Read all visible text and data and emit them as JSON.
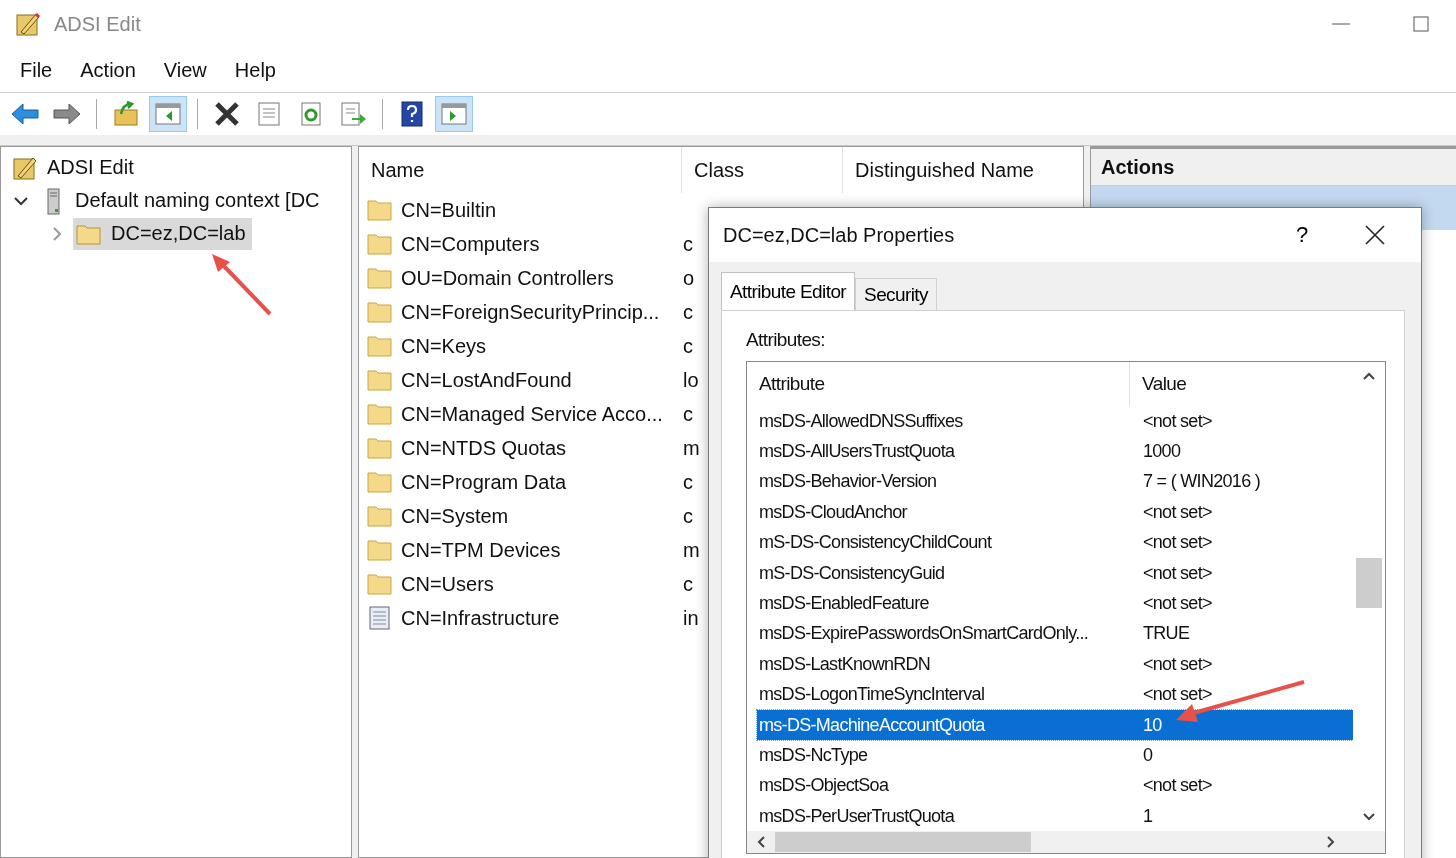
{
  "window": {
    "title": "ADSI Edit"
  },
  "menu": [
    "File",
    "Action",
    "View",
    "Help"
  ],
  "toolbar": [
    {
      "kind": "back",
      "pressed": false
    },
    {
      "kind": "forward",
      "pressed": false
    },
    {
      "kind": "separator"
    },
    {
      "kind": "up-folder",
      "pressed": false
    },
    {
      "kind": "console-tree",
      "pressed": true
    },
    {
      "kind": "separator"
    },
    {
      "kind": "delete",
      "pressed": false
    },
    {
      "kind": "properties",
      "pressed": false
    },
    {
      "kind": "refresh",
      "pressed": false
    },
    {
      "kind": "export",
      "pressed": false
    },
    {
      "kind": "separator"
    },
    {
      "kind": "help",
      "pressed": false
    },
    {
      "kind": "action-pane",
      "pressed": true
    }
  ],
  "tree": [
    {
      "label": "ADSI Edit",
      "kind": "root",
      "selected": false,
      "children": [
        {
          "label": "Default naming context [DC",
          "kind": "server",
          "selected": false,
          "expanded": true,
          "children": [
            {
              "label": "DC=ez,DC=lab",
              "kind": "folder",
              "selected": true,
              "expanded": false
            }
          ]
        }
      ]
    }
  ],
  "list": {
    "columns": [
      "Name",
      "Class",
      "Distinguished Name"
    ],
    "rows": [
      {
        "name": "CN=Builtin",
        "kind": "folder"
      },
      {
        "name": "CN=Computers",
        "kind": "folder",
        "class": "c"
      },
      {
        "name": "OU=Domain Controllers",
        "kind": "folder",
        "class": "o"
      },
      {
        "name": "CN=ForeignSecurityPrincip...",
        "kind": "folder",
        "class": "c"
      },
      {
        "name": "CN=Keys",
        "kind": "folder",
        "class": "c"
      },
      {
        "name": "CN=LostAndFound",
        "kind": "folder",
        "class": "lo"
      },
      {
        "name": "CN=Managed Service Acco...",
        "kind": "folder",
        "class": "c"
      },
      {
        "name": "CN=NTDS Quotas",
        "kind": "folder",
        "class": "m"
      },
      {
        "name": "CN=Program Data",
        "kind": "folder",
        "class": "c"
      },
      {
        "name": "CN=System",
        "kind": "folder",
        "class": "c"
      },
      {
        "name": "CN=TPM Devices",
        "kind": "folder",
        "class": "m"
      },
      {
        "name": "CN=Users",
        "kind": "folder",
        "class": "c"
      },
      {
        "name": "CN=Infrastructure",
        "kind": "document",
        "class": "in"
      }
    ]
  },
  "actions": {
    "title": "Actions"
  },
  "dialog": {
    "title": "DC=ez,DC=lab Properties",
    "help": "?",
    "tabs": [
      {
        "label": "Attribute Editor",
        "selected": true
      },
      {
        "label": "Security",
        "selected": false
      }
    ],
    "attributes_label": "Attributes:",
    "columns": [
      "Attribute",
      "Value"
    ],
    "rows": [
      {
        "attribute": "msDS-AllowedDNSSuffixes",
        "value": "<not set>",
        "selected": false
      },
      {
        "attribute": "msDS-AllUsersTrustQuota",
        "value": "1000",
        "selected": false
      },
      {
        "attribute": "msDS-Behavior-Version",
        "value": "7 = ( WIN2016 )",
        "selected": false
      },
      {
        "attribute": "msDS-CloudAnchor",
        "value": "<not set>",
        "selected": false
      },
      {
        "attribute": "mS-DS-ConsistencyChildCount",
        "value": "<not set>",
        "selected": false
      },
      {
        "attribute": "mS-DS-ConsistencyGuid",
        "value": "<not set>",
        "selected": false
      },
      {
        "attribute": "msDS-EnabledFeature",
        "value": "<not set>",
        "selected": false
      },
      {
        "attribute": "msDS-ExpirePasswordsOnSmartCardOnly...",
        "value": "TRUE",
        "selected": false
      },
      {
        "attribute": "msDS-LastKnownRDN",
        "value": "<not set>",
        "selected": false
      },
      {
        "attribute": "msDS-LogonTimeSyncInterval",
        "value": "<not set>",
        "selected": false
      },
      {
        "attribute": "ms-DS-MachineAccountQuota",
        "value": "10",
        "selected": true
      },
      {
        "attribute": "msDS-NcType",
        "value": "0",
        "selected": false
      },
      {
        "attribute": "msDS-ObjectSoa",
        "value": "<not set>",
        "selected": false
      },
      {
        "attribute": "msDS-PerUserTrustQuota",
        "value": "1",
        "selected": false
      }
    ]
  }
}
